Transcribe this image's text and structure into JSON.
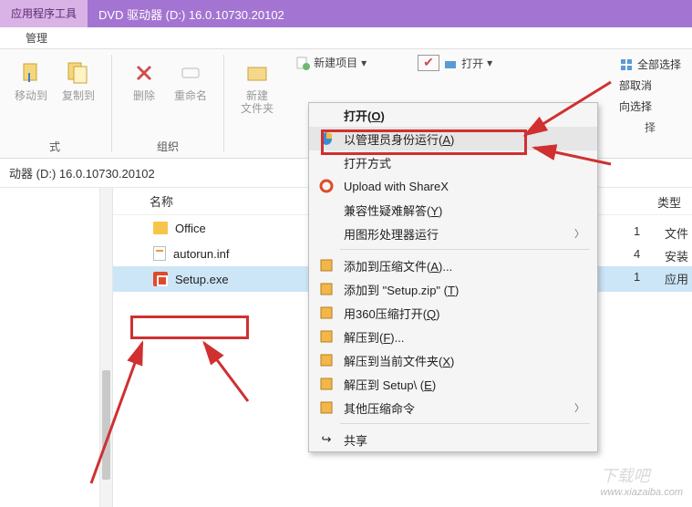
{
  "titlebar": {
    "tool_tab": "应用程序工具",
    "title": "DVD 驱动器 (D:) 16.0.10730.20102",
    "sub_tab": "管理"
  },
  "ribbon": {
    "group1_label": "式",
    "move_to": "移动到",
    "copy_to": "复制到",
    "delete": "删除",
    "rename": "重命名",
    "group2_label": "组织",
    "new_folder": "新建\n文件夹",
    "new_item": "新建项目",
    "open": "打开",
    "select_all": "全部选择",
    "deselect": "部取消",
    "invert_sel": "向选择",
    "select_col": "择"
  },
  "pathbar": {
    "text": "动器 (D:) 16.0.10730.20102"
  },
  "list": {
    "col_name": "名称",
    "col_type": "类型",
    "items": [
      {
        "name": "Office"
      },
      {
        "name": "autorun.inf"
      },
      {
        "name": "Setup.exe"
      }
    ],
    "right_rows": [
      {
        "num": "1",
        "label": "文件"
      },
      {
        "num": "4",
        "label": "安装"
      },
      {
        "num": "1",
        "label": "应用"
      }
    ]
  },
  "ctx": {
    "open": "打开(O)",
    "run_admin": "以管理员身份运行(A)",
    "open_with": "打开方式",
    "sharex": "Upload with ShareX",
    "compat": "兼容性疑难解答(Y)",
    "run_gfx": "用图形处理器运行",
    "add_archive": "添加到压缩文件(A)...",
    "add_zip": "添加到 \"Setup.zip\" (T)",
    "open_360": "用360压缩打开(Q)",
    "extract_to": "解压到(F)...",
    "extract_here": "解压到当前文件夹(X)",
    "extract_folder": "解压到 Setup\\ (E)",
    "other_zip": "其他压缩命令",
    "share": "共享"
  },
  "watermark": {
    "main": "下载吧",
    "sub": "www.xiazaiba.com"
  }
}
